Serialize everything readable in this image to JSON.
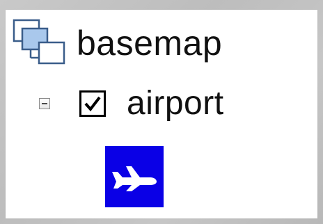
{
  "tree": {
    "group": {
      "label": "basemap",
      "icon": "layer-group-icon"
    },
    "layer": {
      "label": "airport",
      "expanded": true,
      "checked": true,
      "expand_icon": "collapse-minus-icon",
      "symbol": {
        "icon": "airplane-icon",
        "fill_color": "#0a00e6",
        "glyph_color": "#ffffff"
      }
    }
  }
}
